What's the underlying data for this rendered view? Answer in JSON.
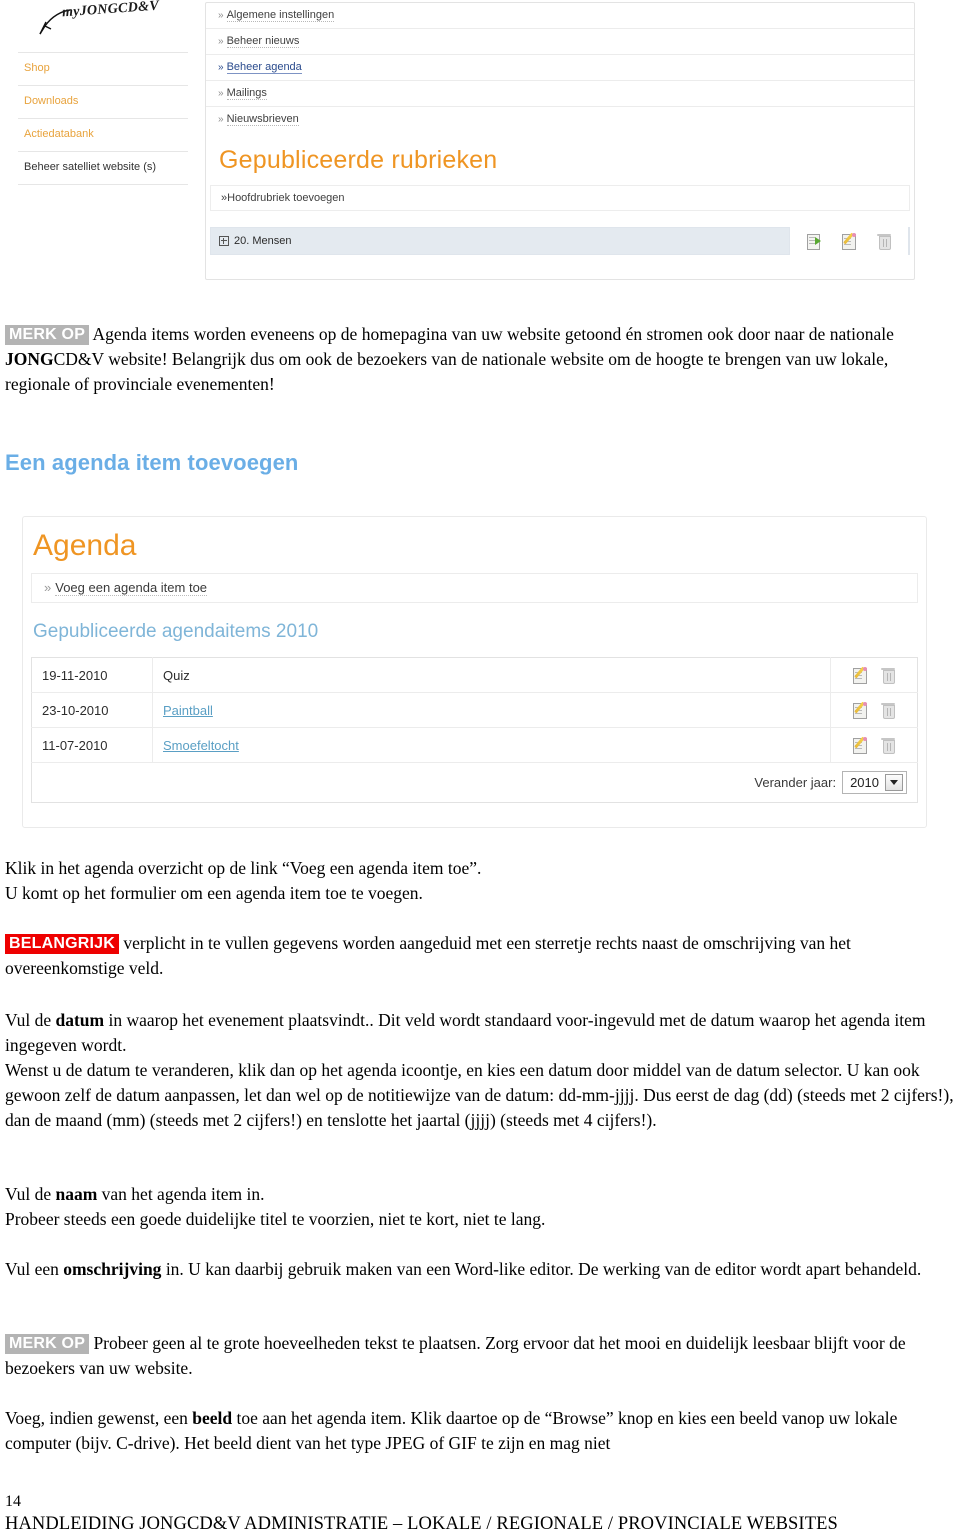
{
  "cms_screenshot_top": {
    "logo": "myJONGCD&V",
    "sidebar": [
      {
        "label": "Shop",
        "style": "link"
      },
      {
        "label": "Downloads",
        "style": "link"
      },
      {
        "label": "Actiedatabank",
        "style": "link"
      },
      {
        "label": "Beheer satelliet website (s)",
        "style": "dark"
      }
    ],
    "nav_items": [
      {
        "label": "Algemene instellingen",
        "active": false
      },
      {
        "label": "Beheer nieuws",
        "active": false
      },
      {
        "label": "Beheer agenda",
        "active": true
      },
      {
        "label": "Mailings",
        "active": false
      },
      {
        "label": "Nieuwsbrieven",
        "active": false
      }
    ],
    "section_title": "Gepubliceerde rubrieken",
    "add_link": "Hoofdrubriek toevoegen",
    "rubriek_row": "20. Mensen",
    "chevron": "»",
    "row_icons": [
      "publish-icon",
      "edit-icon",
      "delete-icon"
    ]
  },
  "note_top": {
    "tag": "MERK OP",
    "text_1": " Agenda items worden eveneens op de homepagina van uw website getoond én stromen ook door naar de nationale ",
    "bold_1": "JONG",
    "text_2": "CD&V website! Belangrijk dus om ook de bezoekers van de nationale website om de hoogte te brengen van uw lokale, regionale of provinciale evenementen!"
  },
  "heading_add_item": "Een agenda item toevoegen",
  "agenda_screenshot": {
    "title": "Agenda",
    "add_link": "Voeg een agenda item toe",
    "chevron": "»",
    "subtitle": "Gepubliceerde agendaitems 2010",
    "rows": [
      {
        "date": "19-11-2010",
        "name": "Quiz",
        "is_link": false
      },
      {
        "date": "23-10-2010",
        "name": "Paintball",
        "is_link": true
      },
      {
        "date": "11-07-2010",
        "name": "Smoefeltocht",
        "is_link": true
      }
    ],
    "row_icons": [
      "edit-icon",
      "delete-icon"
    ],
    "year_label": "Verander jaar:",
    "year_value": "2010"
  },
  "para_klik": {
    "line_1": "Klik in het agenda overzicht op de link “Voeg een agenda item toe”.",
    "line_2": "U komt op het formulier om een agenda item toe te voegen."
  },
  "note_belangrijk": {
    "tag": "BELANGRIJK",
    "text": " verplicht in te vullen gegevens worden aangeduid met een sterretje rechts naast de omschrijving van het overeenkomstige veld."
  },
  "para_datum": {
    "pre": "Vul de ",
    "bold": "datum",
    "post": " in waarop het evenement plaatsvindt.. Dit veld wordt standaard voor-ingevuld met de datum waarop het agenda item ingegeven wordt.",
    "line_2": "Wenst u de datum te veranderen, klik dan op het agenda icoontje, en kies een datum door middel van de datum selector. U kan ook gewoon zelf de datum aanpassen, let dan wel op de notitiewijze van de datum: dd-mm-jjjj. Dus eerst de dag (dd) (steeds met 2 cijfers!), dan de maand (mm) (steeds met 2 cijfers!) en tenslotte het jaartal (jjjj) (steeds met 4 cijfers!)."
  },
  "para_naam": {
    "pre": "Vul de ",
    "bold": "naam",
    "post": " van het agenda item in.",
    "line_2": "Probeer steeds een goede duidelijke titel te voorzien, niet te kort, niet te lang."
  },
  "para_omschrijving": {
    "pre": "Vul een ",
    "bold": "omschrijving",
    "post": " in. U kan daarbij gebruik maken van een Word-like editor. De werking van de editor wordt apart behandeld."
  },
  "note_bottom": {
    "tag": "MERK OP",
    "text": " Probeer geen al te grote hoeveelheden tekst te plaatsen. Zorg ervoor dat het mooi en duidelijk leesbaar blijft voor de bezoekers van uw website."
  },
  "para_beeld": {
    "pre": "Voeg, indien gewenst, een ",
    "bold": "beeld",
    "post": " toe aan het agenda item. Klik daartoe op de “Browse” knop en kies een beeld vanop uw lokale computer (bijv. C-drive). Het beeld dient van het type JPEG of GIF te zijn en mag niet"
  },
  "footer": {
    "page_number": "14",
    "doc_title": "HANDLEIDING JONGCD&V ADMINISTRATIE – LOKALE / REGIONALE / PROVINCIALE WEBSITES"
  },
  "colors": {
    "orange": "#ef9523",
    "blue_heading": "#6aaee6",
    "sub_blue": "#7fb5d8",
    "tag_gray": "#b4b4b4",
    "tag_red": "#ee0000",
    "link_blue": "#5a9fc4",
    "sidebar_link": "#e8a33d"
  }
}
